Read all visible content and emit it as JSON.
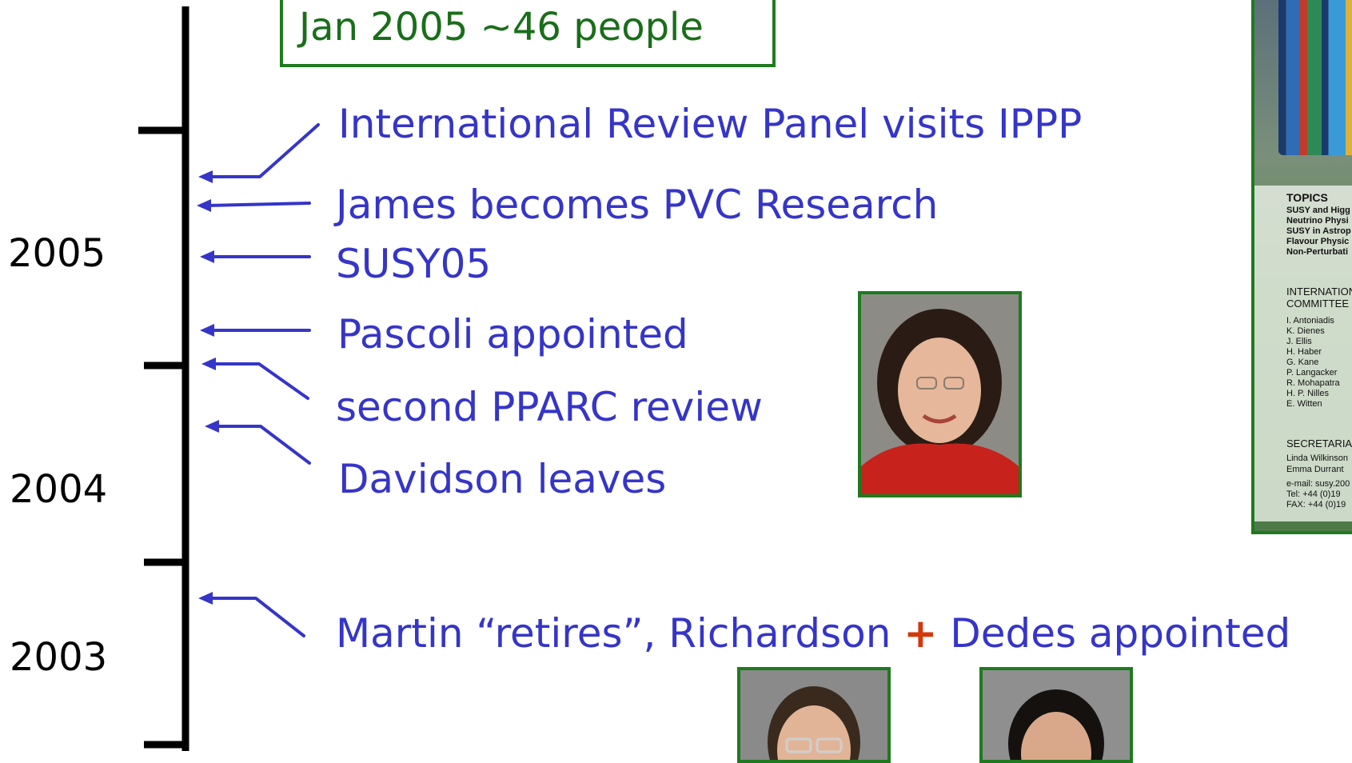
{
  "headcount": "Jan 2005 ~46 people",
  "years": [
    "2005",
    "2004",
    "2003"
  ],
  "events": {
    "review_panel": "International Review Panel visits IPPP",
    "james_pvc": "James becomes PVC Research",
    "susy05": "SUSY05",
    "pascoli": "Pascoli appointed",
    "pparc": "second PPARC review",
    "davidson": "Davidson leaves",
    "martin_part1": "Martin “retires”, Richardson",
    "plus": "+",
    "martin_part2": "Dedes appointed"
  },
  "poster": {
    "topics_heading": "TOPICS",
    "topics": [
      "SUSY and Higg",
      "Neutrino Physi",
      "SUSY in Astrop",
      "Flavour Physic",
      "Non-Perturbati"
    ],
    "committee_heading_1": "INTERNATIONAL",
    "committee_heading_2": "COMMITTEE",
    "committee": [
      "I. Antoniadis",
      "K. Dienes",
      "J. Ellis",
      "H. Haber",
      "G. Kane",
      "P. Langacker",
      "R. Mohapatra",
      "H. P. Nilles",
      "E. Witten"
    ],
    "secretariat_heading": "SECRETARIA",
    "secretariat": [
      "Linda Wilkinson",
      "Emma Durrant"
    ],
    "contact": [
      "e-mail: susy.200",
      "Tel:    +44 (0)19",
      "FAX:  +44 (0)19"
    ]
  },
  "colors": {
    "event_text": "#3535c8",
    "timeline": "#000000",
    "frame": "#1f7a1f",
    "headcount_text": "#1a6e1a",
    "plus": "#d4380d"
  }
}
